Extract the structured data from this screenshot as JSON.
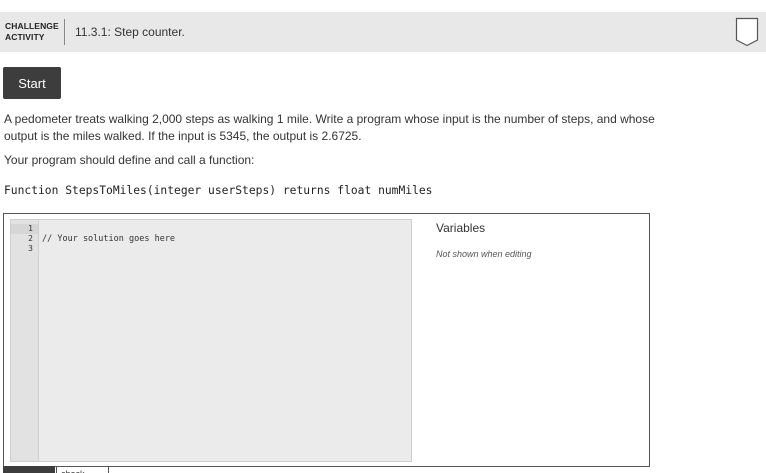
{
  "header": {
    "badge_line1": "CHALLENGE",
    "badge_line2": "ACTIVITY",
    "title": "11.3.1: Step counter.",
    "bookmark_icon": "bookmark-icon"
  },
  "start_label": "Start",
  "description": {
    "line1": "A pedometer treats walking 2,000 steps as walking 1 mile. Write a program whose input is the number of steps, and whose",
    "line2": "output is the miles walked. If the input is 5345, the output is 2.6725.",
    "instruction": "Your program should define and call a function:",
    "signature": "Function StepsToMiles(integer userSteps) returns float numMiles"
  },
  "editor": {
    "line_numbers": [
      "1",
      "2",
      "3"
    ],
    "lines": [
      "",
      "// Your solution goes here",
      ""
    ]
  },
  "variables": {
    "title": "Variables",
    "note": "Not shown when editing"
  },
  "tabs": {
    "second_label": "check"
  }
}
